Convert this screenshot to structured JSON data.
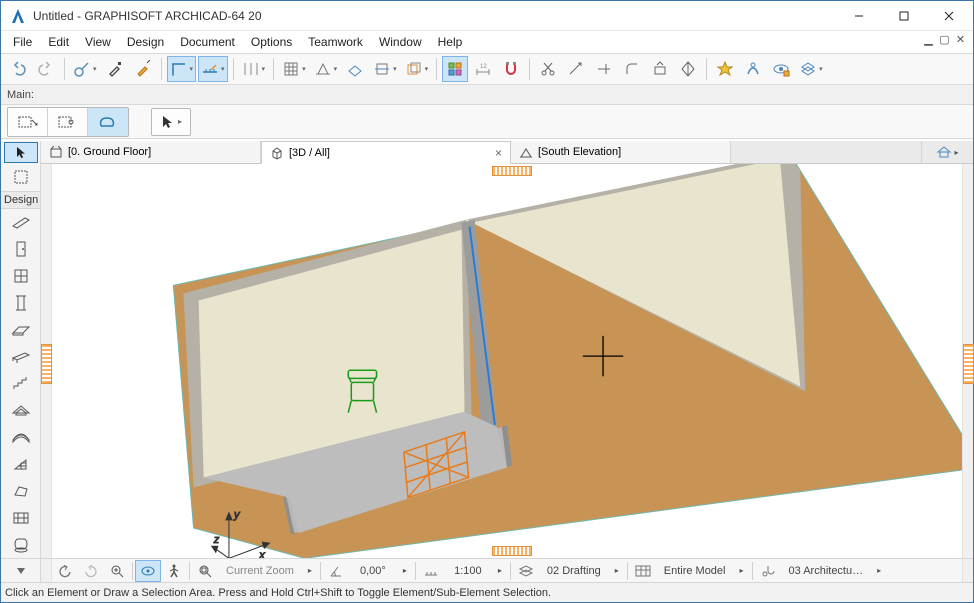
{
  "titlebar": {
    "title": "Untitled - GRAPHISOFT ARCHICAD-64 20"
  },
  "menu": {
    "items": [
      "File",
      "Edit",
      "View",
      "Design",
      "Document",
      "Options",
      "Teamwork",
      "Window",
      "Help"
    ]
  },
  "infobar": {
    "label": "Main:"
  },
  "tabs": {
    "items": [
      {
        "label": "[0. Ground Floor]"
      },
      {
        "label": "[3D / All]"
      },
      {
        "label": "[South Elevation]"
      }
    ]
  },
  "toolbox": {
    "group_label": "Design"
  },
  "viewbar": {
    "current_zoom": "Current Zoom",
    "angle": "0,00°",
    "scale": "1:100",
    "layer_combo": "02 Drafting",
    "model_view": "Entire Model",
    "dim_style": "03 Architectu…"
  },
  "statusbar": {
    "text": "Click an Element or Draw a Selection Area. Press and Hold Ctrl+Shift to Toggle Element/Sub-Element Selection."
  }
}
